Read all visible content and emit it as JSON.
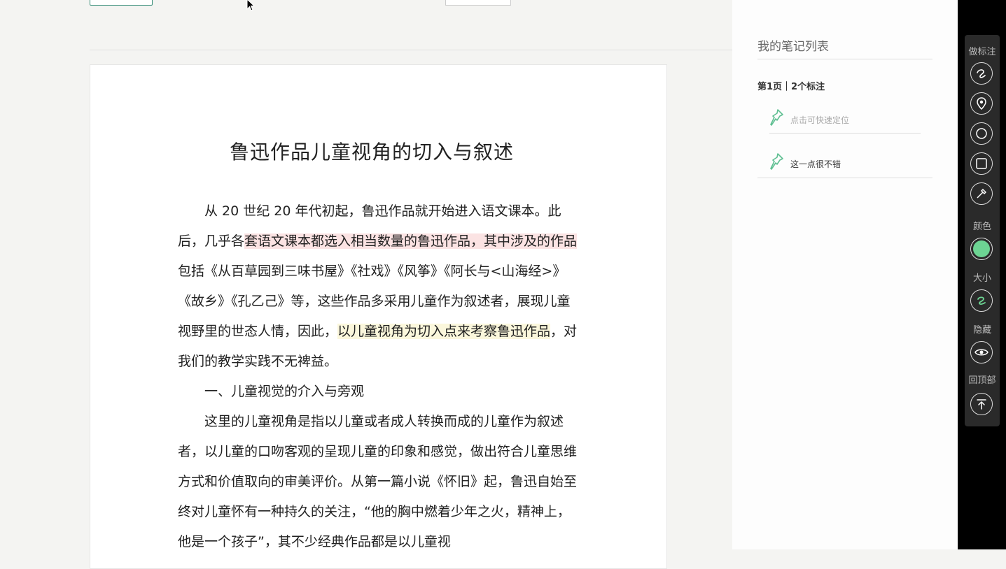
{
  "document": {
    "title": "鲁迅作品儿童视角的切入与叙述",
    "paragraphs": [
      {
        "parts": [
          {
            "text": "从 20 世纪 20 年代初起，鲁迅作品就开始进入语文课本。此后，几乎各"
          },
          {
            "text": "套语文课本都选入相当数量的鲁迅作品，其中涉及的作品",
            "hl": "pink"
          },
          {
            "text": "包括《从百草园到三味书屋》《社戏》《风筝》《阿长与<山海经>》《故乡》《孔乙己》等，这些作品多采用儿童作为叙述者，展现儿童视野里的世态人情，因此，"
          },
          {
            "text": "以儿童视角为切入点来考察鲁迅作品",
            "hl": "yellow"
          },
          {
            "text": "，对我们的教学实践不无裨益。"
          }
        ]
      },
      {
        "parts": [
          {
            "text": "一、儿童视觉的介入与旁观"
          }
        ]
      },
      {
        "parts": [
          {
            "text": "这里的儿童视角是指以儿童或者成人转换而成的儿童作为叙述者，以儿童的口吻客观的呈现儿童的印象和感觉，做出符合儿童思维方式和价值取向的审美评价。从第一篇小说《怀旧》起，鲁迅自始至终对儿童怀有一种持久的关注，“他的胸中燃着少年之火，精神上，他是一个孩子”，其不少经典作品都是以儿童视"
          }
        ]
      }
    ]
  },
  "notes": {
    "title": "我的笔记列表",
    "page_heading": "第1页｜2个标注",
    "items": [
      {
        "text": "点击可快速定位",
        "state": "placeholder"
      },
      {
        "text": "这一点很不错",
        "state": "saved"
      }
    ]
  },
  "toolbar": {
    "annotate_label": "做标注",
    "color_label": "颜色",
    "size_label": "大小",
    "hide_label": "隐藏",
    "top_label": "回顶部",
    "active_color": "#6dd493"
  }
}
